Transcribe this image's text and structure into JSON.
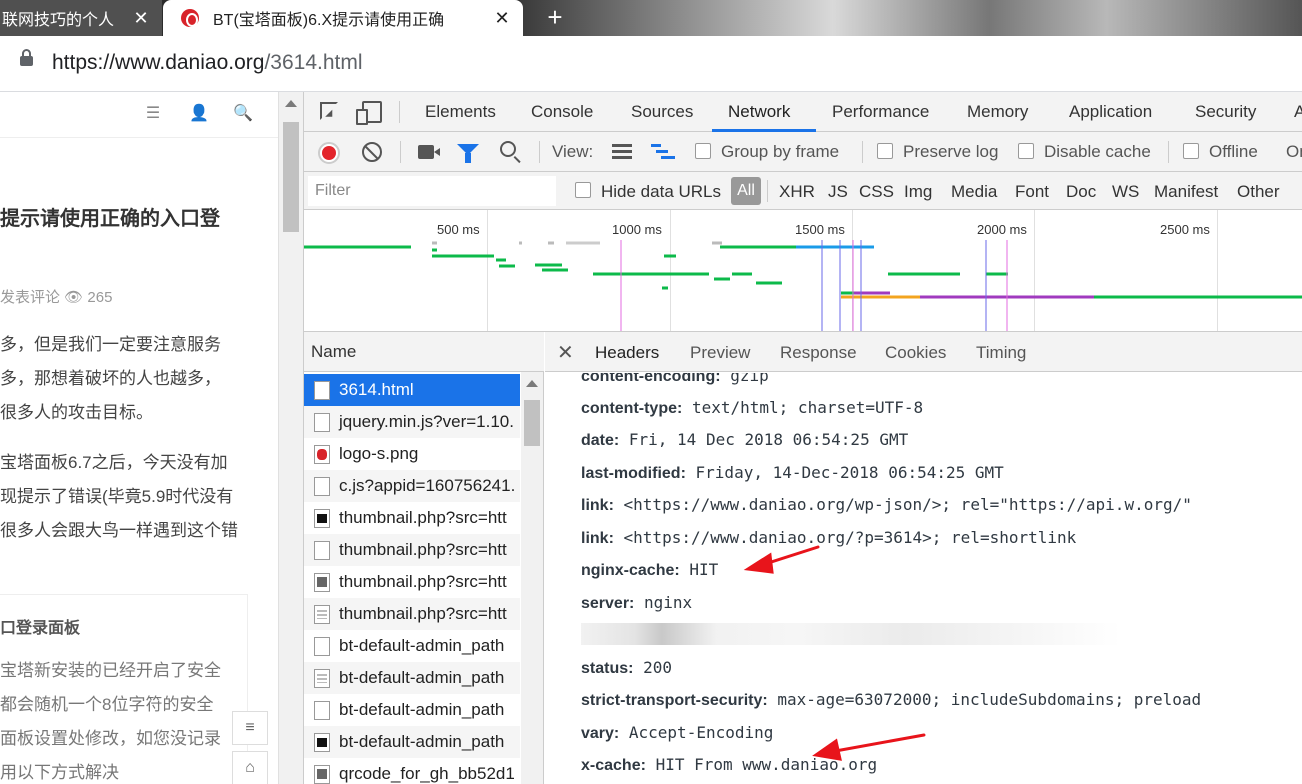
{
  "browser": {
    "tabs": [
      {
        "title": "联网技巧的个人",
        "active": false
      },
      {
        "title": "BT(宝塔面板)6.X提示请使用正确",
        "active": true
      }
    ],
    "address": {
      "host": "https://www.daniao.org",
      "path": "/3614.html"
    }
  },
  "page": {
    "article_title": "提示请使用正确的入口登",
    "meta": "发表评论 👁 265",
    "paragraph1": [
      "多，但是我们一定要注意服务",
      "多，那想着破坏的人也越多，",
      "很多人的攻击目标。"
    ],
    "paragraph2": [
      "宝塔面板6.7之后，今天没有加",
      "现提示了错误(毕竟5.9时代没有",
      "很多人会跟大鸟一样遇到这个错"
    ],
    "box_title": "口登录面板",
    "box_text": [
      "宝塔新安装的已经开启了安全",
      "都会随机一个8位字符的安全",
      "面板设置处修改，如您没记录",
      "用以下方式解决"
    ]
  },
  "devtools": {
    "tool_tabs": [
      "Elements",
      "Console",
      "Sources",
      "Network",
      "Performance",
      "Memory",
      "Application",
      "Security",
      "A"
    ],
    "active_tool_tab": "Network",
    "netbar": {
      "view_label": "View:",
      "group_by_frame": "Group by frame",
      "preserve_log": "Preserve log",
      "disable_cache": "Disable cache",
      "offline": "Offline",
      "online": "On"
    },
    "filter": {
      "placeholder": "Filter",
      "hide_data_urls": "Hide data URLs",
      "types": [
        "All",
        "XHR",
        "JS",
        "CSS",
        "Img",
        "Media",
        "Font",
        "Doc",
        "WS",
        "Manifest",
        "Other"
      ]
    },
    "overview_ticks": [
      "500 ms",
      "1000 ms",
      "1500 ms",
      "2000 ms",
      "2500 ms"
    ],
    "name_header": "Name",
    "requests": [
      {
        "name": "3614.html",
        "icon": "doc"
      },
      {
        "name": "jquery.min.js?ver=1.10.",
        "icon": "doc"
      },
      {
        "name": "logo-s.png",
        "icon": "png"
      },
      {
        "name": "c.js?appid=160756241.",
        "icon": "doc"
      },
      {
        "name": "thumbnail.php?src=htt",
        "icon": "dark"
      },
      {
        "name": "thumbnail.php?src=htt",
        "icon": "doc"
      },
      {
        "name": "thumbnail.php?src=htt",
        "icon": "img"
      },
      {
        "name": "thumbnail.php?src=htt",
        "icon": "thumb2"
      },
      {
        "name": "bt-default-admin_path",
        "icon": "doc"
      },
      {
        "name": "bt-default-admin_path",
        "icon": "thumb2"
      },
      {
        "name": "bt-default-admin_path",
        "icon": "doc"
      },
      {
        "name": "bt-default-admin_path",
        "icon": "dark"
      },
      {
        "name": "qrcode_for_gh_bb52d1",
        "icon": "img"
      }
    ],
    "detail_tabs": [
      "Headers",
      "Preview",
      "Response",
      "Cookies",
      "Timing"
    ],
    "headers": [
      {
        "key": "content-encoding:",
        "value": "gzip"
      },
      {
        "key": "content-type:",
        "value": "text/html; charset=UTF-8"
      },
      {
        "key": "date:",
        "value": "Fri, 14 Dec 2018 06:54:25 GMT"
      },
      {
        "key": "last-modified:",
        "value": "Friday, 14-Dec-2018 06:54:25 GMT"
      },
      {
        "key": "link:",
        "value": "<https://www.daniao.org/wp-json/>; rel=\"https://api.w.org/\""
      },
      {
        "key": "link:",
        "value": "<https://www.daniao.org/?p=3614>; rel=shortlink"
      },
      {
        "key": "nginx-cache:",
        "value": "HIT"
      },
      {
        "key": "server:",
        "value": "nginx"
      },
      {
        "key": "status:",
        "value": "200"
      },
      {
        "key": "strict-transport-security:",
        "value": "max-age=63072000; includeSubdomains; preload"
      },
      {
        "key": "vary:",
        "value": "Accept-Encoding"
      },
      {
        "key": "x-cache:",
        "value": "HIT From www.daniao.org"
      }
    ]
  },
  "colors": {
    "accent": "#1a73e8",
    "annotation_arrow": "#e8141b",
    "record": "#e3242b"
  }
}
